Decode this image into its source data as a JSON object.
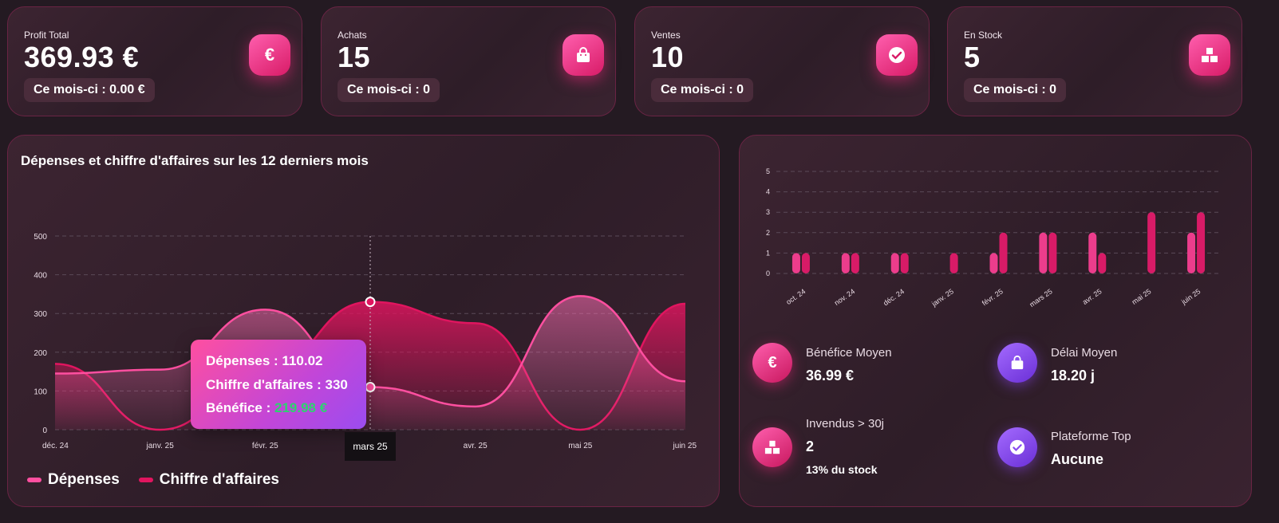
{
  "stats": [
    {
      "label": "Profit Total",
      "value": "369.93 €",
      "month": "Ce mois-ci : 0.00 €",
      "icon": "euro-icon"
    },
    {
      "label": "Achats",
      "value": "15",
      "month": "Ce mois-ci : 0",
      "icon": "shopping-bag-icon"
    },
    {
      "label": "Ventes",
      "value": "10",
      "month": "Ce mois-ci : 0",
      "icon": "check-circle-icon"
    },
    {
      "label": "En Stock",
      "value": "5",
      "month": "Ce mois-ci : 0",
      "icon": "boxes-icon"
    }
  ],
  "main_chart": {
    "title": "Dépenses et chiffre d'affaires sur les 12 derniers mois",
    "legend": [
      "Dépenses",
      "Chiffre d'affaires"
    ],
    "tooltip": {
      "depenses": "Dépenses : 110.02",
      "ca": "Chiffre d'affaires : 330",
      "benefice_label": "Bénéfice : ",
      "benefice_value": "219.98 €"
    },
    "hover_label": "mars 25"
  },
  "metrics": {
    "benefice": {
      "label": "Bénéfice Moyen",
      "value": "36.99 €"
    },
    "delai": {
      "label": "Délai Moyen",
      "value": "18.20 j"
    },
    "invendus": {
      "label": "Invendus > 30j",
      "value": "2",
      "sub": "13% du stock"
    },
    "plateforme": {
      "label": "Plateforme Top",
      "value": "Aucune"
    }
  },
  "colors": {
    "depenses": "#ff4fa0",
    "ca": "#e0155f",
    "accent": "#d81b67",
    "purple": "#8a4cf0"
  },
  "chart_data": [
    {
      "type": "area",
      "title": "Dépenses et chiffre d'affaires sur les 12 derniers mois",
      "categories": [
        "déc. 24",
        "janv. 25",
        "févr. 25",
        "mars 25",
        "avr. 25",
        "mai 25",
        "juin 25"
      ],
      "series": [
        {
          "name": "Dépenses",
          "values": [
            145,
            155,
            310,
            110,
            60,
            345,
            125
          ]
        },
        {
          "name": "Chiffre d'affaires",
          "values": [
            170,
            0,
            160,
            330,
            275,
            0,
            325
          ]
        }
      ],
      "ylim": [
        0,
        500
      ],
      "yticks": [
        "0",
        "100",
        "200",
        "300",
        "400",
        "500"
      ],
      "grid": true,
      "legend": "bottom-left"
    },
    {
      "type": "bar",
      "categories": [
        "oct. 24",
        "nov. 24",
        "déc. 24",
        "janv. 25",
        "févr. 25",
        "mars 25",
        "avr. 25",
        "mai 25",
        "juin 25"
      ],
      "series": [
        {
          "values": [
            1,
            1,
            1,
            0,
            1,
            2,
            2,
            0,
            2
          ]
        },
        {
          "values": [
            1,
            1,
            1,
            1,
            2,
            2,
            1,
            3,
            3
          ]
        }
      ],
      "ylim": [
        0,
        5
      ],
      "yticks": [
        "0",
        "1",
        "2",
        "3",
        "4",
        "5"
      ],
      "grid": true
    }
  ]
}
